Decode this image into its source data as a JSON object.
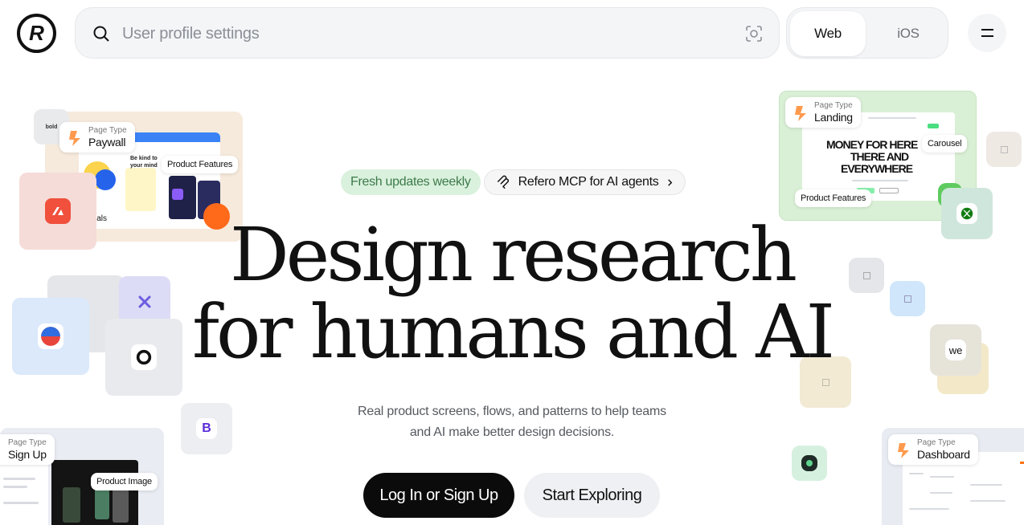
{
  "header": {
    "logo_text": "R",
    "search": {
      "placeholder": "User profile settings"
    },
    "platform_toggle": {
      "web": "Web",
      "ios": "iOS"
    }
  },
  "hero": {
    "badge_fresh": "Fresh updates weekly",
    "badge_mcp": "Refero MCP for AI agents",
    "headline_line1": "Design research",
    "headline_line2": "for humans and AI",
    "subtitle_line1": "Real product screens, flows, and patterns to help teams",
    "subtitle_line2": "and AI make better design decisions.",
    "cta_primary": "Log In or Sign Up",
    "cta_secondary": "Start Exploring"
  },
  "floating_cards": {
    "page_type_small": "Page Type",
    "paywall": {
      "type": "Paywall",
      "tag": "Product Features",
      "mini_text": "Be kind to your mind",
      "partial_label": "ials"
    },
    "landing": {
      "type": "Landing",
      "tag_carousel": "Carousel",
      "tag_features": "Product Features",
      "banner_line1": "MONEY FOR HERE",
      "banner_line2": "THERE AND",
      "banner_line3": "EVERYWHERE"
    },
    "signup": {
      "type": "Sign Up",
      "tag": "Product Image"
    },
    "dashboard": {
      "type": "Dashboard"
    },
    "we_tile": "we",
    "b_tile": "B",
    "bold_tile": "bold"
  },
  "colors": {
    "accent_dark": "#0b0b0c",
    "badge_green_bg": "#d9f1dd",
    "badge_green_text": "#3e7a4a",
    "orange": "#ff6a1a"
  }
}
